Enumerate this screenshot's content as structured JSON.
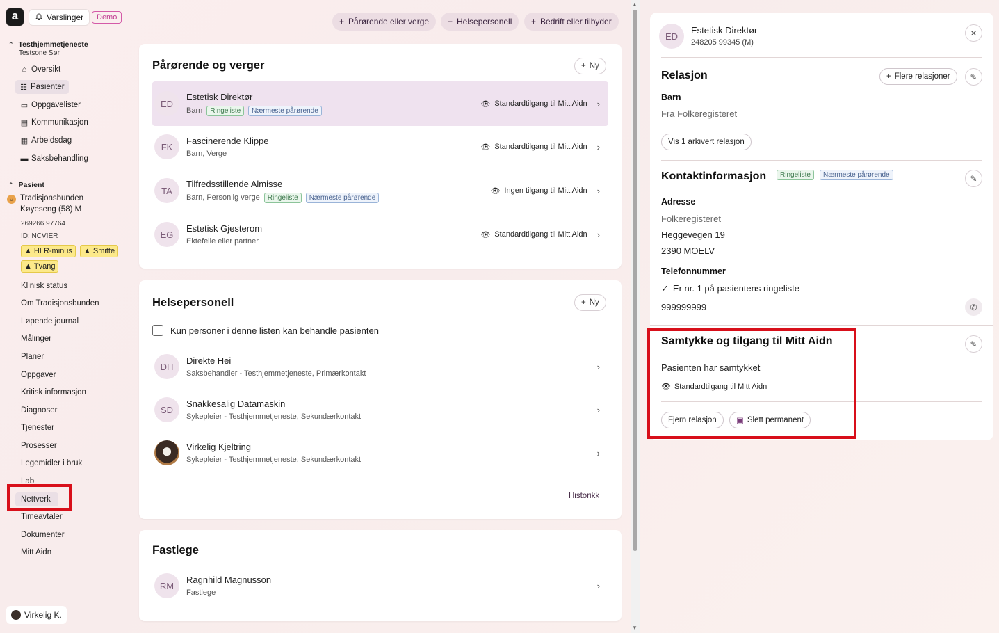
{
  "header": {
    "logo": "a",
    "notifications_label": "Varslinger",
    "demo_label": "Demo"
  },
  "nav": {
    "org_name": "Testhjemmetjeneste",
    "org_zone": "Testsone Sør",
    "org_items": [
      {
        "label": "Oversikt",
        "icon": "home-icon"
      },
      {
        "label": "Pasienter",
        "icon": "people-icon"
      },
      {
        "label": "Oppgavelister",
        "icon": "clipboard-icon"
      },
      {
        "label": "Kommunikasjon",
        "icon": "message-icon"
      },
      {
        "label": "Arbeidsdag",
        "icon": "calendar-icon"
      },
      {
        "label": "Saksbehandling",
        "icon": "folder-icon"
      }
    ],
    "patient_section": "Pasient",
    "patient_name_line1": "Tradisjonsbunden",
    "patient_name_line2": "Køyeseng (58) M",
    "patient_number": "269266 97764",
    "patient_id": "ID: NCVIER",
    "warnings": [
      "HLR-minus",
      "Smitte",
      "Tvang"
    ],
    "patient_items": [
      "Klinisk status",
      "Om Tradisjonsbunden",
      "Løpende journal",
      "Målinger",
      "Planer",
      "Oppgaver",
      "Kritisk informasjon",
      "Diagnoser",
      "Tjenester",
      "Prosesser",
      "Legemidler i bruk",
      "Lab",
      "Nettverk",
      "Timeavtaler",
      "Dokumenter",
      "Mitt Aidn"
    ],
    "user_label": "Virkelig K."
  },
  "top_buttons": [
    "Pårørende eller verge",
    "Helsepersonell",
    "Bedrift eller tilbyder"
  ],
  "relatives": {
    "title": "Pårørende og verger",
    "new_label": "Ny",
    "rows": [
      {
        "initials": "ED",
        "name": "Estetisk Direktør",
        "sub": "Barn",
        "tags": [
          "Ringeliste",
          "Nærmeste pårørende"
        ],
        "access": "Standardtilgang til Mitt Aidn",
        "access_icon": "eye-icon"
      },
      {
        "initials": "FK",
        "name": "Fascinerende Klippe",
        "sub": "Barn, Verge",
        "tags": [],
        "access": "Standardtilgang til Mitt Aidn",
        "access_icon": "eye-icon"
      },
      {
        "initials": "TA",
        "name": "Tilfredsstillende Almisse",
        "sub": "Barn, Personlig verge",
        "tags": [
          "Ringeliste",
          "Nærmeste pårørende"
        ],
        "access": "Ingen tilgang til Mitt Aidn",
        "access_icon": "eye-off-icon"
      },
      {
        "initials": "EG",
        "name": "Estetisk Gjesterom",
        "sub": "Ektefelle eller partner",
        "tags": [],
        "access": "Standardtilgang til Mitt Aidn",
        "access_icon": "eye-icon"
      }
    ]
  },
  "health": {
    "title": "Helsepersonell",
    "new_label": "Ny",
    "checkbox_label": "Kun personer i denne listen kan behandle pasienten",
    "rows": [
      {
        "initials": "DH",
        "name": "Direkte Hei",
        "sub": "Saksbehandler - Testhjemmetjeneste, Primærkontakt"
      },
      {
        "initials": "SD",
        "name": "Snakkesalig Datamaskin",
        "sub": "Sykepleier - Testhjemmetjeneste, Sekundærkontakt"
      },
      {
        "initials": "",
        "name": "Virkelig Kjeltring",
        "sub": "Sykepleier - Testhjemmetjeneste, Sekundærkontakt"
      }
    ],
    "history_label": "Historikk"
  },
  "gp": {
    "title": "Fastlege",
    "rows": [
      {
        "initials": "RM",
        "name": "Ragnhild Magnusson",
        "sub": "Fastlege"
      }
    ]
  },
  "detail": {
    "initials": "ED",
    "name": "Estetisk Direktør",
    "subline": "248205 99345 (M)",
    "relation": {
      "title": "Relasjon",
      "more_label": "Flere relasjoner",
      "type": "Barn",
      "source": "Fra Folkeregisteret",
      "archived_label": "Vis 1 arkivert relasjon"
    },
    "contact": {
      "title": "Kontaktinformasjon",
      "tags": [
        "Ringeliste",
        "Nærmeste pårørende"
      ],
      "address_label": "Adresse",
      "address_source": "Folkeregisteret",
      "street": "Heggevegen 19",
      "city": "2390 MOELV",
      "phone_label": "Telefonnummer",
      "ringlist_note": "Er nr. 1 på pasientens ringeliste",
      "phone": "999999999"
    },
    "consent": {
      "title": "Samtykke og tilgang til Mitt Aidn",
      "status": "Pasienten har samtykket",
      "access": "Standardtilgang til Mitt Aidn"
    },
    "remove_label": "Fjern relasjon",
    "delete_label": "Slett permanent"
  }
}
